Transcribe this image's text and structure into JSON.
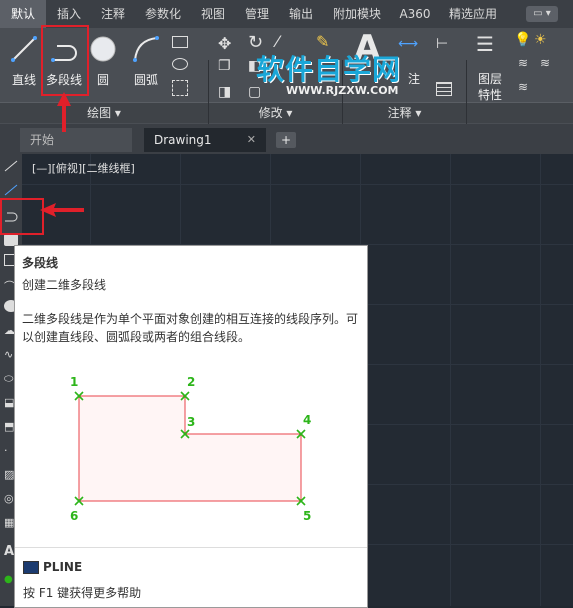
{
  "menu": {
    "items": [
      "默认",
      "插入",
      "注释",
      "参数化",
      "视图",
      "管理",
      "输出",
      "附加模块",
      "A360",
      "精选应用"
    ],
    "extra_label": "▭"
  },
  "ribbon": {
    "draw_tools": {
      "line": "直线",
      "polyline": "多段线",
      "circle": "圆",
      "arc": "圆弧"
    },
    "panels": {
      "draw": "绘图",
      "modify": "修改",
      "annotation": "注释"
    },
    "layer": {
      "label_line1": "图层",
      "label_line2": "特性"
    },
    "annotation_partial": "注"
  },
  "tabs": {
    "start": "开始",
    "drawing": "Drawing1",
    "add": "+",
    "close": "✕"
  },
  "viewport": {
    "label": "[—][俯视][二维线框]"
  },
  "watermark": {
    "title": "软件自学网",
    "url": "WWW.RJZXW.COM"
  },
  "tooltip": {
    "title": "多段线",
    "subtitle": "创建二维多段线",
    "description": "二维多段线是作为单个平面对象创建的相互连接的线段序列。可以创建直线段、圆弧段或两者的组合线段。",
    "points": [
      "1",
      "2",
      "3",
      "4",
      "5",
      "6"
    ],
    "command": "PLINE",
    "help": "按 F1 键获得更多帮助"
  },
  "colors": {
    "highlight": "#e0202a",
    "point_label": "#2db51a",
    "polyline": "#e8434a"
  }
}
